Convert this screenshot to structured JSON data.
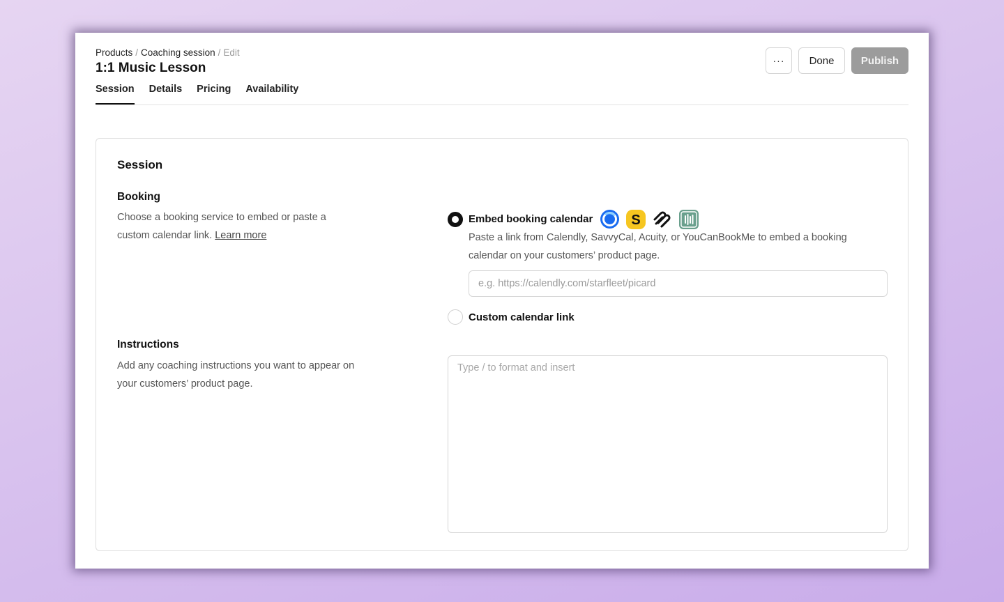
{
  "breadcrumb": {
    "items": [
      "Products",
      "Coaching session",
      "Edit"
    ],
    "separator": "/"
  },
  "page_title": "1:1 Music Lesson",
  "tabs": [
    {
      "label": "Session",
      "active": true
    },
    {
      "label": "Details",
      "active": false
    },
    {
      "label": "Pricing",
      "active": false
    },
    {
      "label": "Availability",
      "active": false
    }
  ],
  "header_actions": {
    "more_label": "···",
    "done_label": "Done",
    "publish_label": "Publish"
  },
  "card": {
    "title": "Session",
    "booking": {
      "heading": "Booking",
      "description": "Choose a booking service to embed or paste a custom calendar link.",
      "learn_more": "Learn more"
    },
    "instructions": {
      "heading": "Instructions",
      "description": "Add any coaching instructions you want to appear on your customers’ product page.",
      "placeholder": "Type / to format and insert"
    },
    "options": {
      "embed": {
        "label": "Embed booking calendar",
        "selected": true,
        "description": "Paste a link from Calendly, SavvyCal, Acuity, or YouCanBookMe to embed a booking calendar on your customers’ product page.",
        "input_placeholder": "e.g. https://calendly.com/starfleet/picard",
        "input_value": ""
      },
      "custom": {
        "label": "Custom calendar link",
        "selected": false
      }
    },
    "brand_icons": [
      "calendly-icon",
      "savvycal-icon",
      "acuity-icon",
      "youcanbookme-icon"
    ]
  },
  "colors": {
    "background_start": "#e6d5f2",
    "background_end": "#c9acea",
    "publish_button": "#9c9c9c",
    "calendly_blue": "#1a6cf0",
    "savvycal_yellow": "#f6c620",
    "youcanbookme_green": "#6aa08d"
  }
}
